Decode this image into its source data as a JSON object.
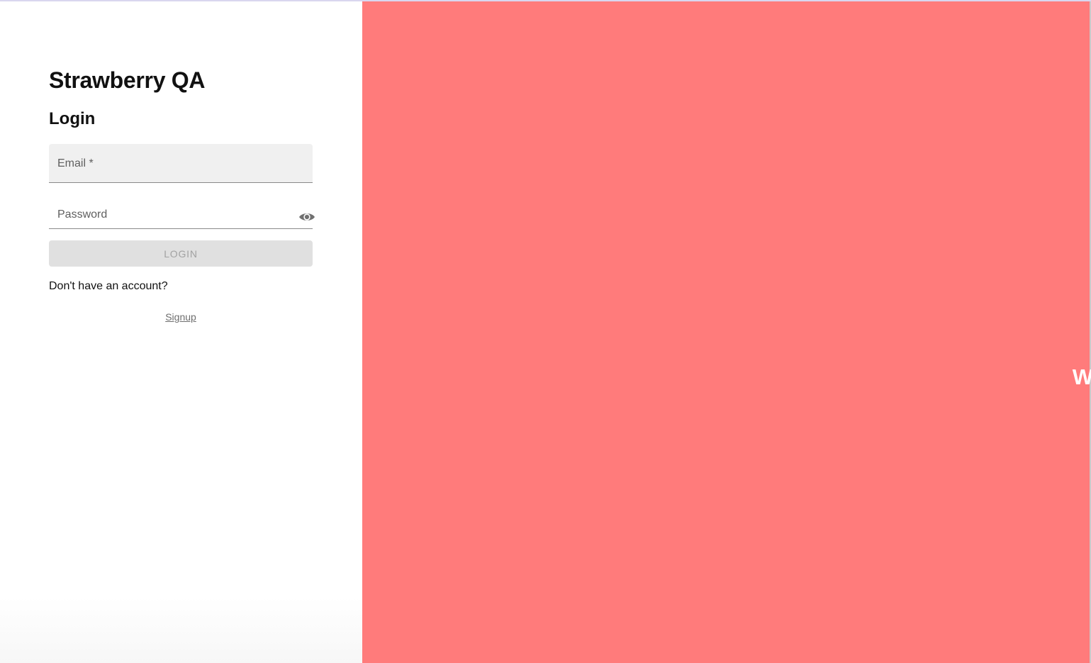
{
  "left_panel": {
    "brand_title": "Strawberry QA",
    "form_title": "Login",
    "email_field": {
      "label": "Email *",
      "value": ""
    },
    "password_field": {
      "label": "Password",
      "value": "",
      "toggle_icon": "eye-icon"
    },
    "login_button": "LOGIN",
    "account_prompt": "Don't have an account?",
    "signup_link": "Signup"
  },
  "right_panel": {
    "welcome_message": "Welcome to the Strawberry QA Chapter website!",
    "background_color": "#ff7b7b"
  },
  "colors": {
    "accent": "#ff7b7b",
    "button_disabled_bg": "#e0e0e0",
    "button_disabled_text": "#a2a2a2"
  }
}
